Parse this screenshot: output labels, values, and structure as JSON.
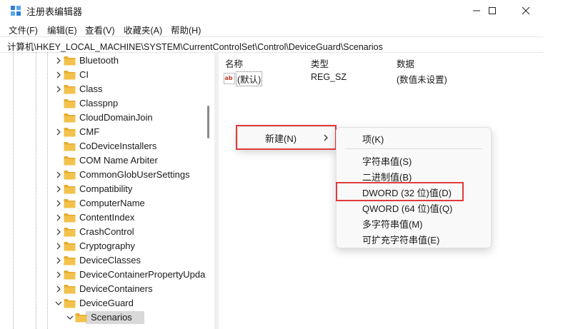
{
  "window": {
    "title": "注册表编辑器",
    "minimize_icon": "minimize-icon",
    "maximize_icon": "maximize-icon",
    "close_icon": "close-icon"
  },
  "menu": [
    "文件(F)",
    "编辑(E)",
    "查看(V)",
    "收藏夹(A)",
    "帮助(H)"
  ],
  "address": "计算机\\HKEY_LOCAL_MACHINE\\SYSTEM\\CurrentControlSet\\Control\\DeviceGuard\\Scenarios",
  "tree": [
    {
      "label": "Bluetooth",
      "expander": "collapsed"
    },
    {
      "label": "CI",
      "expander": "collapsed"
    },
    {
      "label": "Class",
      "expander": "collapsed"
    },
    {
      "label": "Classpnp",
      "expander": "none"
    },
    {
      "label": "CloudDomainJoin",
      "expander": "none"
    },
    {
      "label": "CMF",
      "expander": "collapsed"
    },
    {
      "label": "CoDeviceInstallers",
      "expander": "none"
    },
    {
      "label": "COM Name Arbiter",
      "expander": "none"
    },
    {
      "label": "CommonGlobUserSettings",
      "expander": "collapsed"
    },
    {
      "label": "Compatibility",
      "expander": "collapsed"
    },
    {
      "label": "ComputerName",
      "expander": "collapsed"
    },
    {
      "label": "ContentIndex",
      "expander": "collapsed"
    },
    {
      "label": "CrashControl",
      "expander": "collapsed"
    },
    {
      "label": "Cryptography",
      "expander": "collapsed"
    },
    {
      "label": "DeviceClasses",
      "expander": "collapsed"
    },
    {
      "label": "DeviceContainerPropertyUpda",
      "expander": "collapsed"
    },
    {
      "label": "DeviceContainers",
      "expander": "collapsed"
    },
    {
      "label": "DeviceGuard",
      "expander": "expanded"
    },
    {
      "label": "Scenarios",
      "expander": "expanded",
      "selected": true
    }
  ],
  "values_pane": {
    "headers": {
      "name": "名称",
      "type": "类型",
      "data": "数据"
    },
    "rows": [
      {
        "name": "(默认)",
        "type": "REG_SZ",
        "data": "(数值未设置)",
        "icon": "string-value-icon"
      }
    ]
  },
  "context_menu": {
    "new_label": "新建(N)",
    "submenu": [
      {
        "label": "项(K)"
      },
      {
        "label": "字符串值(S)"
      },
      {
        "label": "二进制值(B)"
      },
      {
        "label": "DWORD (32 位)值(D)",
        "highlighted": true
      },
      {
        "label": "QWORD (64 位)值(Q)"
      },
      {
        "label": "多字符串值(M)"
      },
      {
        "label": "可扩充字符串值(E)"
      }
    ]
  },
  "colors": {
    "highlight_border": "#e03a3a",
    "folder": "#f2c24c",
    "selection": "#d9d9d9"
  }
}
